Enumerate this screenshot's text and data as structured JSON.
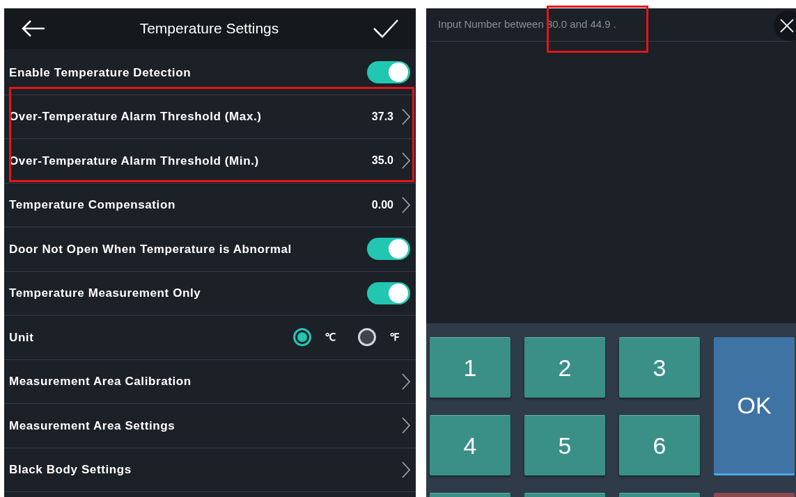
{
  "settings": {
    "title": "Temperature Settings",
    "rows": [
      {
        "kind": "toggle",
        "label": "Enable Temperature Detection",
        "on": true
      },
      {
        "kind": "value",
        "label": "Over-Temperature Alarm Threshold (Max.)",
        "value": "37.3"
      },
      {
        "kind": "value",
        "label": "Over-Temperature Alarm Threshold (Min.)",
        "value": "35.0"
      },
      {
        "kind": "value",
        "label": "Temperature Compensation",
        "value": "0.00"
      },
      {
        "kind": "toggle",
        "label": "Door Not Open When Temperature is Abnormal",
        "on": true
      },
      {
        "kind": "toggle",
        "label": "Temperature Measurement Only",
        "on": true
      },
      {
        "kind": "radio",
        "label": "Unit",
        "options": [
          {
            "label": "℃",
            "selected": true
          },
          {
            "label": "℉",
            "selected": false
          }
        ]
      },
      {
        "kind": "link",
        "label": "Measurement Area Calibration"
      },
      {
        "kind": "link",
        "label": "Measurement Area Settings"
      },
      {
        "kind": "link",
        "label": "Black Body Settings"
      }
    ]
  },
  "input_dialog": {
    "placeholder": "Input Number between 30.0 and 44.9 .",
    "keys": [
      "1",
      "2",
      "3",
      "4",
      "5",
      "6"
    ],
    "ok": "OK"
  }
}
